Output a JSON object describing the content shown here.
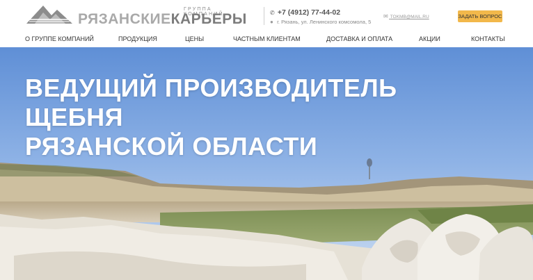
{
  "header": {
    "logo": {
      "tagline": "ГРУППА КОМПАНИЙ",
      "name_part1": "РЯЗАНСКИЕ",
      "name_part2": "КАРЬЕРЫ"
    },
    "phone": "+7 (4912) 77-44-02",
    "address": "г. Рязань, ул. Ленинского комсомола, 5",
    "email": "TOKMB@MAIL.RU",
    "ask_button": "ЗАДАТЬ ВОПРОС"
  },
  "nav": {
    "items": [
      "О ГРУППЕ КОМПАНИЙ",
      "ПРОДУКЦИЯ",
      "ЦЕНЫ",
      "ЧАСТНЫМ КЛИЕНТАМ",
      "ДОСТАВКА И ОПЛАТА",
      "АКЦИИ",
      "КОНТАКТЫ"
    ]
  },
  "hero": {
    "title_lines": [
      "ВЕДУЩИЙ ПРОИЗВОДИТЕЛЬ",
      "ЩЕБНЯ",
      "РЯЗАНСКОЙ ОБЛАСТИ"
    ]
  },
  "icons": [
    "mountains-logo-icon",
    "phone-icon",
    "location-pin-icon",
    "email-icon"
  ],
  "colors": {
    "accent": "#f2b84b",
    "logo_light": "#a9a9a9",
    "logo_dark": "#7c7c7c",
    "text": "#333333"
  }
}
